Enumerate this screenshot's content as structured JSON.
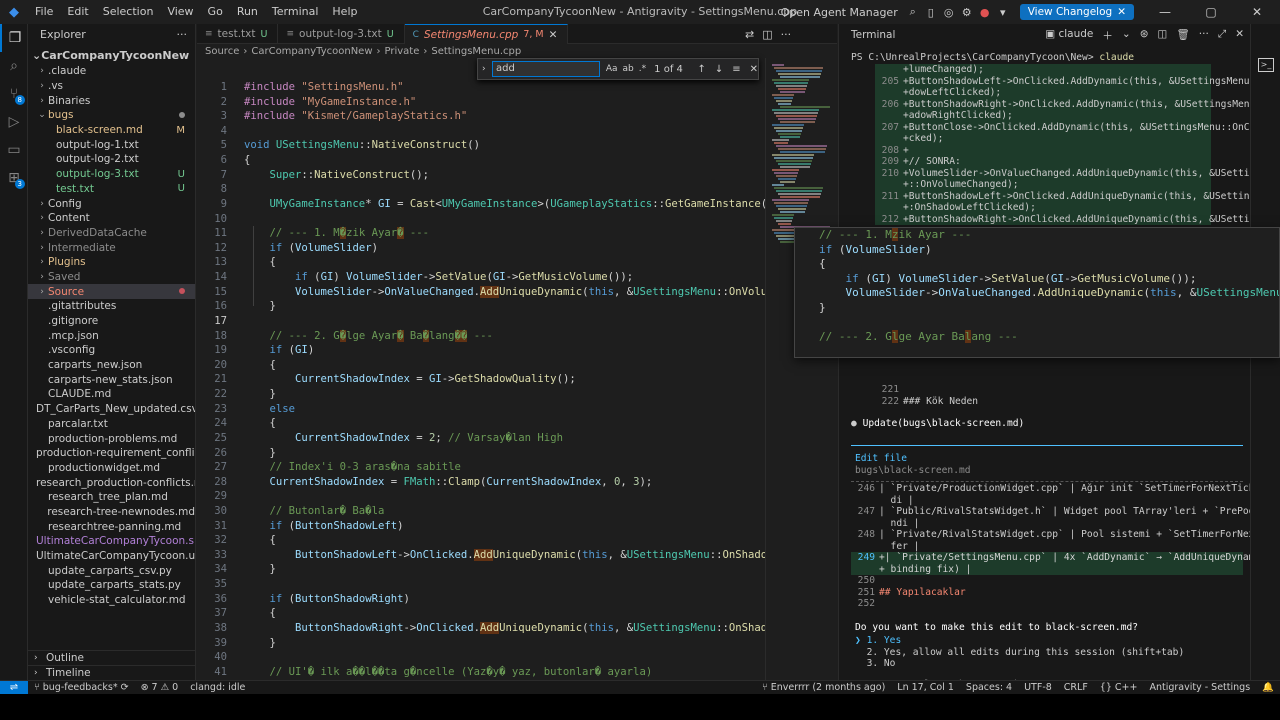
{
  "titlebar": {
    "menu": [
      "File",
      "Edit",
      "Selection",
      "View",
      "Go",
      "Run",
      "Terminal",
      "Help"
    ],
    "title": "CarCompanyTycoonNew - Antigravity - SettingsMenu.cpp",
    "open_agent_manager": "Open Agent Manager",
    "view_changelog": "View Changelog"
  },
  "activity": {
    "badge_source": "8",
    "badge_ext": "3"
  },
  "sidebar": {
    "header": "Explorer",
    "root": "CarCompanyTycoonNew",
    "items": [
      {
        "label": ".claude",
        "type": "folder",
        "indent": 1
      },
      {
        "label": ".vs",
        "type": "folder",
        "indent": 1
      },
      {
        "label": "Binaries",
        "type": "folder",
        "indent": 1
      },
      {
        "label": "bugs",
        "type": "folder-open",
        "indent": 1,
        "color": "yellow",
        "status": "dot"
      },
      {
        "label": "black-screen.md",
        "type": "file",
        "indent": 2,
        "color": "yellow",
        "status": "M"
      },
      {
        "label": "output-log-1.txt",
        "type": "file",
        "indent": 2
      },
      {
        "label": "output-log-2.txt",
        "type": "file",
        "indent": 2
      },
      {
        "label": "output-log-3.txt",
        "type": "file",
        "indent": 2,
        "color": "green",
        "status": "U"
      },
      {
        "label": "test.txt",
        "type": "file",
        "indent": 2,
        "color": "green",
        "status": "U"
      },
      {
        "label": "Config",
        "type": "folder",
        "indent": 1
      },
      {
        "label": "Content",
        "type": "folder",
        "indent": 1
      },
      {
        "label": "DerivedDataCache",
        "type": "folder",
        "indent": 1,
        "color": "gray"
      },
      {
        "label": "Intermediate",
        "type": "folder",
        "indent": 1,
        "color": "gray"
      },
      {
        "label": "Plugins",
        "type": "folder",
        "indent": 1,
        "color": "yellow"
      },
      {
        "label": "Saved",
        "type": "folder",
        "indent": 1,
        "color": "gray"
      },
      {
        "label": "Source",
        "type": "folder",
        "indent": 1,
        "color": "red",
        "status": "dot-red",
        "selected": true
      },
      {
        "label": ".gitattributes",
        "type": "file",
        "indent": 1
      },
      {
        "label": ".gitignore",
        "type": "file",
        "indent": 1
      },
      {
        "label": ".mcp.json",
        "type": "file",
        "indent": 1
      },
      {
        "label": ".vsconfig",
        "type": "file",
        "indent": 1
      },
      {
        "label": "carparts_new.json",
        "type": "file",
        "indent": 1
      },
      {
        "label": "carparts-new_stats.json",
        "type": "file",
        "indent": 1
      },
      {
        "label": "CLAUDE.md",
        "type": "file",
        "indent": 1
      },
      {
        "label": "DT_CarParts_New_updated.csv",
        "type": "file",
        "indent": 1
      },
      {
        "label": "parcalar.txt",
        "type": "file",
        "indent": 1
      },
      {
        "label": "production-problems.md",
        "type": "file",
        "indent": 1
      },
      {
        "label": "production-requirement_conflict...",
        "type": "file",
        "indent": 1
      },
      {
        "label": "productionwidget.md",
        "type": "file",
        "indent": 1
      },
      {
        "label": "research_production-conflicts.md",
        "type": "file",
        "indent": 1
      },
      {
        "label": "research_tree_plan.md",
        "type": "file",
        "indent": 1
      },
      {
        "label": "research-tree-newnodes.md",
        "type": "file",
        "indent": 1
      },
      {
        "label": "researchtree-panning.md",
        "type": "file",
        "indent": 1
      },
      {
        "label": "UltimateCarCompanyTycoon.sln",
        "type": "file",
        "indent": 1,
        "color": "purple"
      },
      {
        "label": "UltimateCarCompanyTycoon.upr...",
        "type": "file",
        "indent": 1
      },
      {
        "label": "update_carparts_csv.py",
        "type": "file",
        "indent": 1
      },
      {
        "label": "update_carparts_stats.py",
        "type": "file",
        "indent": 1
      },
      {
        "label": "vehicle-stat_calculator.md",
        "type": "file",
        "indent": 1
      }
    ],
    "outline": "Outline",
    "timeline": "Timeline"
  },
  "tabs": [
    {
      "label": "test.txt",
      "mark": "U"
    },
    {
      "label": "output-log-3.txt",
      "mark": "U"
    },
    {
      "label": "SettingsMenu.cpp",
      "mark": "7, M",
      "active": true
    }
  ],
  "breadcrumb": [
    "Source",
    "CarCompanyTycoonNew",
    "Private",
    "SettingsMenu.cpp"
  ],
  "find": {
    "query": "add",
    "count": "1 of 4"
  },
  "code": [
    {
      "n": "1",
      "html": "<span class='mac'>#include</span> <span class='str'>\"SettingsMenu.h\"</span>"
    },
    {
      "n": "2",
      "html": "<span class='mac'>#include</span> <span class='str'>\"MyGameInstance.h\"</span>"
    },
    {
      "n": "3",
      "html": "<span class='mac'>#include</span> <span class='str'>\"Kismet/GameplayStatics.h\"</span>"
    },
    {
      "n": "4",
      "html": ""
    },
    {
      "n": "5",
      "html": "<span class='kw'>void</span> <span class='ty'>USettingsMenu</span><span class='tx'>::</span><span class='fn'>NativeConstruct</span><span class='tx'>()</span>"
    },
    {
      "n": "6",
      "html": "<span class='tx'>{</span>"
    },
    {
      "n": "7",
      "html": "    <span class='ty'>Super</span><span class='tx'>::</span><span class='fn'>NativeConstruct</span><span class='tx'>();</span>"
    },
    {
      "n": "8",
      "html": ""
    },
    {
      "n": "9",
      "html": "    <span class='ty'>UMyGameInstance</span><span class='tx'>* </span><span class='mem'>GI</span><span class='tx'> = </span><span class='fn'>Cast</span><span class='tx'>&lt;</span><span class='ty'>UMyGameInstance</span><span class='tx'>&gt;(</span><span class='ty'>UGameplayStatics</span><span class='tx'>::</span><span class='fn'>GetGameInstance</span><span class='tx'>(</span><span class='kw'>this</span><span class='tx'>));</span>"
    },
    {
      "n": "10",
      "html": ""
    },
    {
      "n": "11",
      "html": "    <span class='cm'>// --- 1. M�zik Ayar� ---</span>",
      "hl": true
    },
    {
      "n": "12",
      "html": "    <span class='kw'>if</span><span class='tx'> (</span><span class='mem'>VolumeSlider</span><span class='tx'>)</span>"
    },
    {
      "n": "13",
      "html": "    <span class='tx'>{</span>"
    },
    {
      "n": "14",
      "html": "        <span class='kw'>if</span><span class='tx'> (</span><span class='mem'>GI</span><span class='tx'>) </span><span class='mem'>VolumeSlider</span><span class='tx'>-&gt;</span><span class='fn'>SetValue</span><span class='tx'>(</span><span class='mem'>GI</span><span class='tx'>-&gt;</span><span class='fn'>GetMusicVolume</span><span class='tx'>());</span>"
    },
    {
      "n": "15",
      "html": "        <span class='mem'>VolumeSlider</span><span class='tx'>-&gt;</span><span class='mem'>OnValueChanged</span><span class='tx'>.</span><span class='fn find-hl'>Add</span><span class='fn'>UniqueDynamic</span><span class='tx'>(</span><span class='kw'>this</span><span class='tx'>, &amp;</span><span class='ty'>USettingsMenu</span><span class='tx'>::</span><span class='fn'>OnVolumeChanged</span><span class='tx'>);</span>"
    },
    {
      "n": "16",
      "html": "    <span class='tx'>}</span>"
    },
    {
      "n": "17",
      "html": "",
      "cur": true
    },
    {
      "n": "18",
      "html": "    <span class='cm'>// --- 2. G�lge Ayar� Ba�lang�� ---</span>",
      "hl": true
    },
    {
      "n": "19",
      "html": "    <span class='kw'>if</span><span class='tx'> (</span><span class='mem'>GI</span><span class='tx'>)</span>"
    },
    {
      "n": "20",
      "html": "    <span class='tx'>{</span>"
    },
    {
      "n": "21",
      "html": "        <span class='mem'>CurrentShadowIndex</span><span class='tx'> = </span><span class='mem'>GI</span><span class='tx'>-&gt;</span><span class='fn'>GetShadowQuality</span><span class='tx'>();</span>"
    },
    {
      "n": "22",
      "html": "    <span class='tx'>}</span>"
    },
    {
      "n": "23",
      "html": "    <span class='kw'>else</span>"
    },
    {
      "n": "24",
      "html": "    <span class='tx'>{</span>"
    },
    {
      "n": "25",
      "html": "        <span class='mem'>CurrentShadowIndex</span><span class='tx'> = </span><span class='nm'>2</span><span class='tx'>; </span><span class='cm'>// Varsay�lan High</span>"
    },
    {
      "n": "26",
      "html": "    <span class='tx'>}</span>"
    },
    {
      "n": "27",
      "html": "    <span class='cm'>// Index'i 0-3 aras�na sabitle</span>"
    },
    {
      "n": "28",
      "html": "    <span class='mem'>CurrentShadowIndex</span><span class='tx'> = </span><span class='ty'>FMath</span><span class='tx'>::</span><span class='fn'>Clamp</span><span class='tx'>(</span><span class='mem'>CurrentShadowIndex</span><span class='tx'>, </span><span class='nm'>0</span><span class='tx'>, </span><span class='nm'>3</span><span class='tx'>);</span>"
    },
    {
      "n": "29",
      "html": ""
    },
    {
      "n": "30",
      "html": "    <span class='cm'>// Butonlar� Ba�la</span>"
    },
    {
      "n": "31",
      "html": "    <span class='kw'>if</span><span class='tx'> (</span><span class='mem'>ButtonShadowLeft</span><span class='tx'>)</span>"
    },
    {
      "n": "32",
      "html": "    <span class='tx'>{</span>"
    },
    {
      "n": "33",
      "html": "        <span class='mem'>ButtonShadowLeft</span><span class='tx'>-&gt;</span><span class='mem'>OnClicked</span><span class='tx'>.</span><span class='fn find-hl'>Add</span><span class='fn'>UniqueDynamic</span><span class='tx'>(</span><span class='kw'>this</span><span class='tx'>, &amp;</span><span class='ty'>USettingsMenu</span><span class='tx'>::</span><span class='fn'>OnShadowLeftClicked</span><span class='tx'>);</span>"
    },
    {
      "n": "34",
      "html": "    <span class='tx'>}</span>"
    },
    {
      "n": "35",
      "html": ""
    },
    {
      "n": "36",
      "html": "    <span class='kw'>if</span><span class='tx'> (</span><span class='mem'>ButtonShadowRight</span><span class='tx'>)</span>"
    },
    {
      "n": "37",
      "html": "    <span class='tx'>{</span>"
    },
    {
      "n": "38",
      "html": "        <span class='mem'>ButtonShadowRight</span><span class='tx'>-&gt;</span><span class='mem'>OnClicked</span><span class='tx'>.</span><span class='fn find-hl'>Add</span><span class='fn'>UniqueDynamic</span><span class='tx'>(</span><span class='kw'>this</span><span class='tx'>, &amp;</span><span class='ty'>USettingsMenu</span><span class='tx'>::</span><span class='fn'>OnShadowRightClicked</span><span class='tx'>);</span>"
    },
    {
      "n": "39",
      "html": "    <span class='tx'>}</span>"
    },
    {
      "n": "40",
      "html": ""
    },
    {
      "n": "41",
      "html": "    <span class='cm'>// UI'� ilk a��l��ta g�ncelle (Yaz�y� yaz, butonlar� ayarla)</span>"
    }
  ],
  "overlay": [
    "<span class='cm'>// --- 1. M</span><span class='cm hl'>z</span><span class='cm'>ik Ayar ---</span>",
    "<span class='kw'>if</span><span class='tx'> (</span><span class='mem'>VolumeSlider</span><span class='tx'>)</span>",
    "<span class='tx'>{</span>",
    "    <span class='kw'>if</span><span class='tx'> (</span><span class='mem'>GI</span><span class='tx'>) </span><span class='mem'>VolumeSlider</span><span class='tx'>-&gt;</span><span class='fn'>SetValue</span><span class='tx'>(</span><span class='mem'>GI</span><span class='tx'>-&gt;</span><span class='fn'>GetMusicVolume</span><span class='tx'>());</span>",
    "    <span class='mem'>VolumeSlider</span><span class='tx'>-&gt;</span><span class='mem'>OnValueChanged</span><span class='tx'>.</span><span class='fn'>AddUniqueDynamic</span><span class='tx'>(</span><span class='kw'>this</span><span class='tx'>, &amp;</span><span class='ty'>USettingsMenu</span><span class='tx'>::</span><span class='fn'>OnVo</span>",
    "<span class='tx'>}</span>",
    "",
    "<span class='cm'>// --- 2. G</span><span class='cm hl'>l</span><span class='cm'>ge Ayar Ba</span><span class='cm hl'>l</span><span class='cm'>ang ---</span>"
  ],
  "terminal": {
    "title": "Terminal",
    "shell": "claude",
    "prompt": "PS C:\\UnrealProjects\\CarCompanyTycoon\\New> ",
    "command": "claude",
    "lines": [
      {
        "ln": "",
        "text": "+lumeChanged);",
        "add": true
      },
      {
        "ln": "205",
        "text": "+ButtonShadowLeft->OnClicked.AddDynamic(this, &USettingsMenu::OnSha",
        "add": true
      },
      {
        "ln": "",
        "text": "+dowLeftClicked);",
        "add": true
      },
      {
        "ln": "206",
        "text": "+ButtonShadowRight->OnClicked.AddDynamic(this, &USettingsMenu::OnSh",
        "add": true
      },
      {
        "ln": "",
        "text": "+adowRightClicked);",
        "add": true
      },
      {
        "ln": "207",
        "text": "+ButtonClose->OnClicked.AddDynamic(this, &USettingsMenu::OnCloseCli",
        "add": true
      },
      {
        "ln": "",
        "text": "+cked);",
        "add": true
      },
      {
        "ln": "208",
        "text": "+",
        "add": true
      },
      {
        "ln": "209",
        "text": "+// SONRA:",
        "add": true
      },
      {
        "ln": "210",
        "text": "+VolumeSlider->OnValueChanged.AddUniqueDynamic(this, &USettingsMenu",
        "add": true
      },
      {
        "ln": "",
        "text": "+::OnVolumeChanged);",
        "add": true
      },
      {
        "ln": "211",
        "text": "+ButtonShadowLeft->OnClicked.AddUniqueDynamic(this, &USettingsMenu:",
        "add": true
      },
      {
        "ln": "",
        "text": "+:OnShadowLeftClicked);",
        "add": true
      },
      {
        "ln": "212",
        "text": "+ButtonShadowRight->OnClicked.AddUniqueDynamic(this, &USettingsMenu",
        "add": true
      }
    ],
    "after": [
      {
        "ln": "221",
        "text": ""
      },
      {
        "ln": "222",
        "text": "### Kök Neden"
      }
    ],
    "update_line": "Update(bugs\\black-screen.md)",
    "edit_title": "Edit file",
    "edit_path": "bugs\\black-screen.md",
    "edit_lines": [
      {
        "ln": "246",
        "text": "| `Private/ProductionWidget.cpp` | Ağır init `SetTimerForNextTick` ile ertelen"
      },
      {
        "ln": "",
        "text": "  di |"
      },
      {
        "ln": "247",
        "text": "| `Public/RivalStatsWidget.h` | Widget pool TArray'leri + `PrePoolBars()` ekle"
      },
      {
        "ln": "",
        "text": "  ndi |"
      },
      {
        "ln": "248",
        "text": "| `Private/RivalStatsWidget.cpp` | Pool sistemi + `SetTimerForNextTick` ile de"
      },
      {
        "ln": "",
        "text": "  fer |"
      },
      {
        "ln": "249",
        "text": "+| `Private/SettingsMenu.cpp` | 4x `AddDynamic` → `AddUniqueDynamic` (duplicate",
        "sel": true
      },
      {
        "ln": "",
        "text": "+ binding fix) |",
        "sel": true
      },
      {
        "ln": "250",
        "text": ""
      },
      {
        "ln": "251",
        "text": "## Yapılacaklar"
      },
      {
        "ln": "252",
        "text": ""
      }
    ],
    "question": "Do you want to make this edit to black-screen.md?",
    "options": [
      "1. Yes",
      "2. Yes, allow all edits during this session (shift+tab)",
      "3. No"
    ],
    "footer": "Esc to cancel · Tab to amend"
  },
  "status": {
    "branch": "bug-feedbacks*",
    "problems": "⊗ 7 ⚠ 0",
    "clangd": "clangd: idle",
    "blame": "Enverrrr (2 months ago)",
    "position": "Ln 17, Col 1",
    "spaces": "Spaces: 4",
    "encoding": "UTF-8",
    "eol": "CRLF",
    "lang": "{} C++",
    "app": "Antigravity - Settings"
  }
}
